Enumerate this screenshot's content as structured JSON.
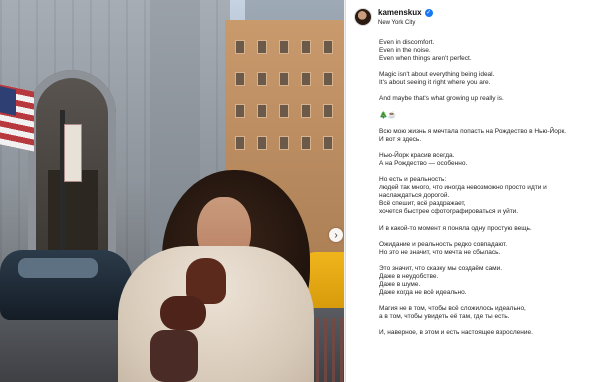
{
  "header": {
    "username": "kamenskux",
    "location": "New York City",
    "verified_icon": "verified-badge-icon"
  },
  "photo": {
    "next_icon": "chevron-right-icon",
    "next_glyph": "›"
  },
  "caption": {
    "lines": [
      "Even in discomfort.",
      "Even in the noise.",
      "Even when things aren't perfect.",
      "",
      "Magic isn't about everything being ideal.",
      "It's about seeing it right where you are.",
      "",
      "And maybe that's what growing up really is.",
      "",
      "🎄☕",
      "",
      "Всю мою жизнь я мечтала попасть на Рождество в Нью-Йорк.",
      "И вот я здесь.",
      "",
      "Нью-Йорк красив всегда.",
      "А на Рождество — особенно.",
      "",
      "Но есть и реальность:",
      "людей так много, что иногда невозможно просто идти и",
      "наслаждаться дорогой.",
      "Всё спешит, всё раздражает,",
      "хочется быстрее сфотографироваться и уйти.",
      "",
      "И в какой-то момент я поняла одну простую вещь.",
      "",
      "Ожидание и реальность редко совпадают.",
      "Но это не значит, что мечта не сбылась.",
      "",
      "Это значит, что сказку мы создаём сами.",
      "Даже в неудобстве.",
      "Даже в шуме.",
      "Даже когда не всё идеально.",
      "",
      "Магия не в том, чтобы всё сложилось идеально,",
      "а в том, чтобы увидеть её там, где ты есть.",
      "",
      "И, наверное, в этом и есть настоящее взросление."
    ]
  }
}
